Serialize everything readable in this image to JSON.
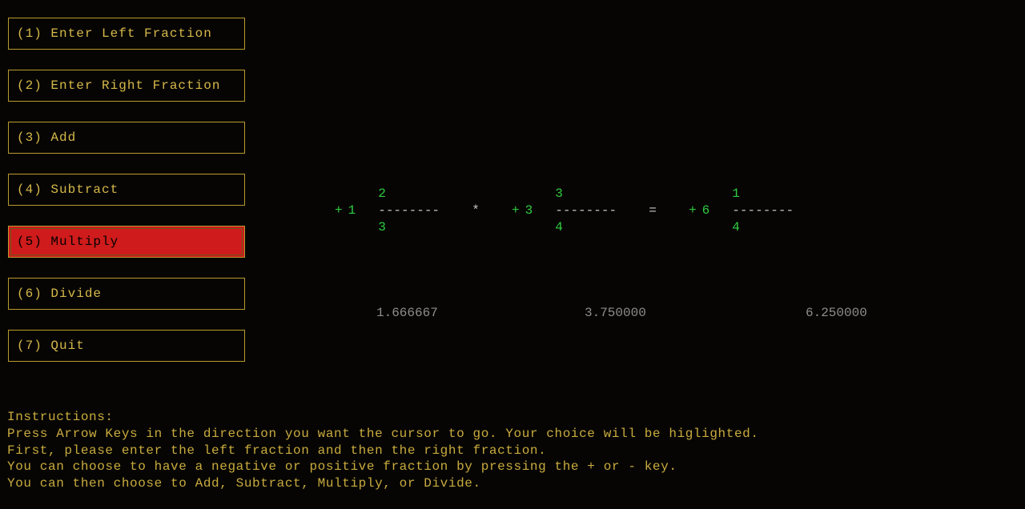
{
  "menu": {
    "items": [
      {
        "label": "(1) Enter Left Fraction"
      },
      {
        "label": "(2) Enter Right  Fraction"
      },
      {
        "label": "(3) Add"
      },
      {
        "label": "(4) Subtract"
      },
      {
        "label": "(5) Multiply"
      },
      {
        "label": "(6) Divide"
      },
      {
        "label": "(7) Quit"
      }
    ],
    "selected_index": 4
  },
  "expr": {
    "left": {
      "sign": "+",
      "whole": "1",
      "num": "2",
      "den": "3",
      "dashes": "--------"
    },
    "op": "*",
    "right": {
      "sign": "+",
      "whole": "3",
      "num": "3",
      "den": "4",
      "dashes": "--------"
    },
    "eq": "=",
    "result": {
      "sign": "+",
      "whole": "6",
      "num": "1",
      "den": "4",
      "dashes": "--------"
    }
  },
  "decimals": {
    "left": "1.666667",
    "right": "3.750000",
    "result": "6.250000"
  },
  "instructions": {
    "title": "Instructions:",
    "l1": "Press Arrow Keys in the direction you want the cursor to go. Your choice will be higlighted.",
    "l2": "First, please enter the left fraction and then the right fraction.",
    "l3": "You can choose to have a negative or positive fraction by pressing the + or - key.",
    "l4": "You can then choose to Add, Subtract, Multiply, or Divide."
  }
}
